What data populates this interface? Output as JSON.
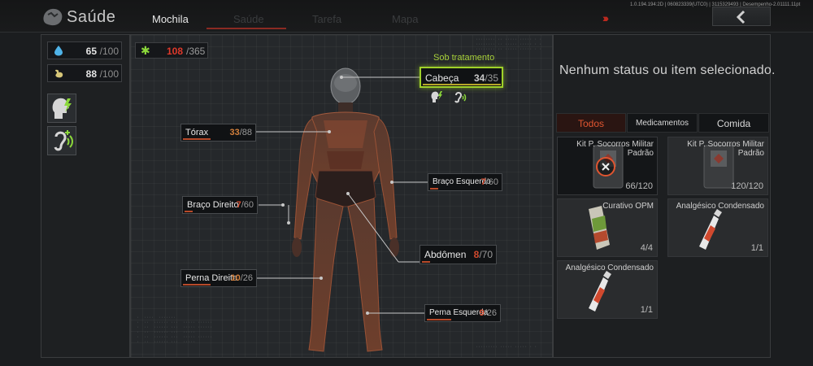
{
  "header": {
    "app_title": "Saúde",
    "tabs": [
      {
        "label": "Mochila",
        "active": true
      },
      {
        "label": "Saúde",
        "active": false
      },
      {
        "label": "Tarefa",
        "active": false
      },
      {
        "label": "Mapa",
        "active": false
      }
    ],
    "build_info": "1.0.194.194:2D | 060823339(UTC0) | 3115329493 | Desempenho-2.01111.11pt",
    "back_icon": "chevron-left-icon",
    "arrows_icon": "triple-chevron-right-icon"
  },
  "stats": {
    "hydration": {
      "icon": "water-drop-icon",
      "value": "65",
      "max": "/100"
    },
    "energy": {
      "icon": "stomach-icon",
      "value": "88",
      "max": "/100"
    }
  },
  "status_effects": [
    {
      "icon": "head-lightning-icon"
    },
    {
      "icon": "ear-tinnitus-icon"
    }
  ],
  "total_hp": {
    "icon": "medical-cross-icon",
    "current": "108",
    "max": "/365"
  },
  "body_parts": {
    "head": {
      "label": "Cabeça",
      "current": "34",
      "max": "/35",
      "status_label": "Sob tratamento"
    },
    "thorax": {
      "label": "Tórax",
      "current": "33",
      "max": "/88"
    },
    "left_arm": {
      "label": "Braço Esquerdo",
      "current": "7",
      "max": "/60"
    },
    "right_arm": {
      "label": "Braço Direito",
      "current": "7",
      "max": "/60"
    },
    "abdomen": {
      "label": "Abdômen",
      "current": "8",
      "max": "/70"
    },
    "right_leg": {
      "label": "Perna Direita",
      "current": "10",
      "max": "/26"
    },
    "left_leg": {
      "label": "Perna Esquerda",
      "current": "9",
      "max": "/26"
    }
  },
  "detail": {
    "empty_text": "Nenhum status ou item selecionado."
  },
  "categories": [
    {
      "label": "Todos",
      "active": true
    },
    {
      "label": "Medicamentos",
      "active": false
    },
    {
      "label": "Comida",
      "active": false
    }
  ],
  "items": [
    {
      "name": "Kit P. Socorros Militar Padrão",
      "qty": "66/120",
      "icon": "first-aid-kit-icon",
      "selected": true
    },
    {
      "name": "Kit P. Socorros Militar Padrão",
      "qty": "120/120",
      "icon": "first-aid-kit-icon",
      "selected": false
    },
    {
      "name": "Curativo OPM",
      "qty": "4/4",
      "icon": "bandage-icon",
      "selected": false
    },
    {
      "name": "Analgésico Condensado",
      "qty": "1/1",
      "icon": "spray-bottle-icon",
      "selected": false
    },
    {
      "name": "Analgésico Condensado",
      "qty": "1/1",
      "icon": "spray-bottle-icon",
      "selected": false
    }
  ],
  "colors": {
    "accent_red": "#e0392b",
    "accent_orange": "#e05530",
    "treat_green": "#9fd12a",
    "bg": "#1b1d1f"
  }
}
